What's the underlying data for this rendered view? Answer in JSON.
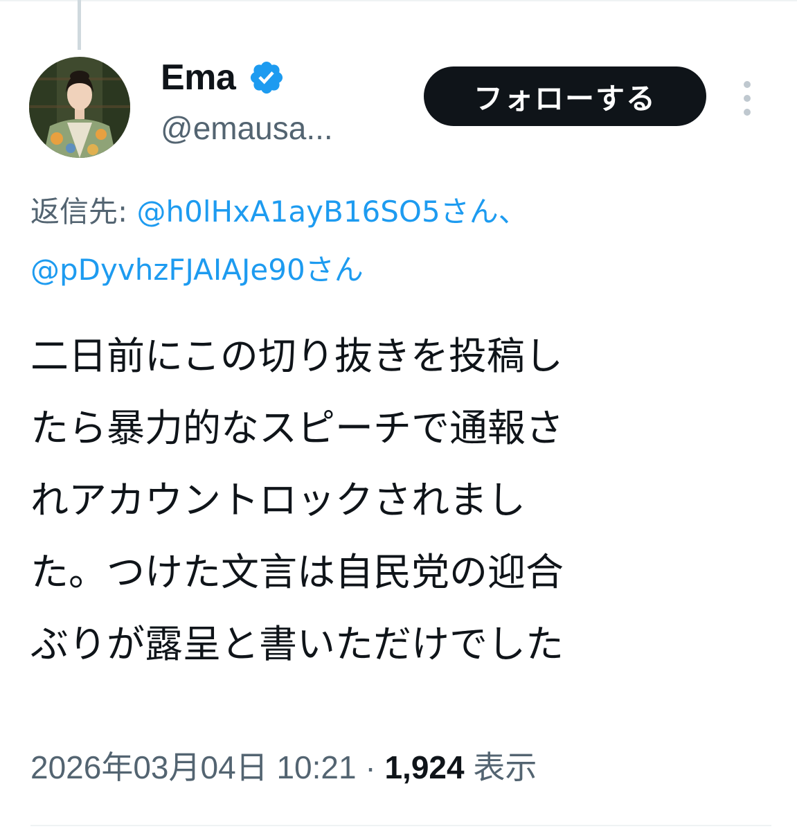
{
  "author": {
    "display_name": "Ema",
    "handle": "@emausa...",
    "verified": true,
    "avatar_icon": "profile-photo-woman-kimono"
  },
  "actions": {
    "follow_label": "フォローする",
    "more_icon": "more-vertical-icon"
  },
  "reply_to": {
    "prefix": "返信先: ",
    "mentions": [
      "@h0lHxA1ayB16SO5さん",
      "@pDyvhzFJAIAJe90さん"
    ],
    "separator": "、"
  },
  "tweet": {
    "lines": [
      "二日前にこの切り抜きを投稿し",
      "たら暴力的なスピーチで通報さ",
      "れアカウントロックされまし",
      "た。つけた文言は自民党の迎合",
      "ぶりが露呈と書いただけでした"
    ]
  },
  "meta": {
    "timestamp": "2026年03月04日 10:21",
    "separator": " · ",
    "views_count": "1,924",
    "views_label": " 表示"
  },
  "colors": {
    "text": "#0f1419",
    "secondary": "#536471",
    "link": "#1d9bf0",
    "verified": "#1d9bf0",
    "button_bg": "#0f1419"
  }
}
